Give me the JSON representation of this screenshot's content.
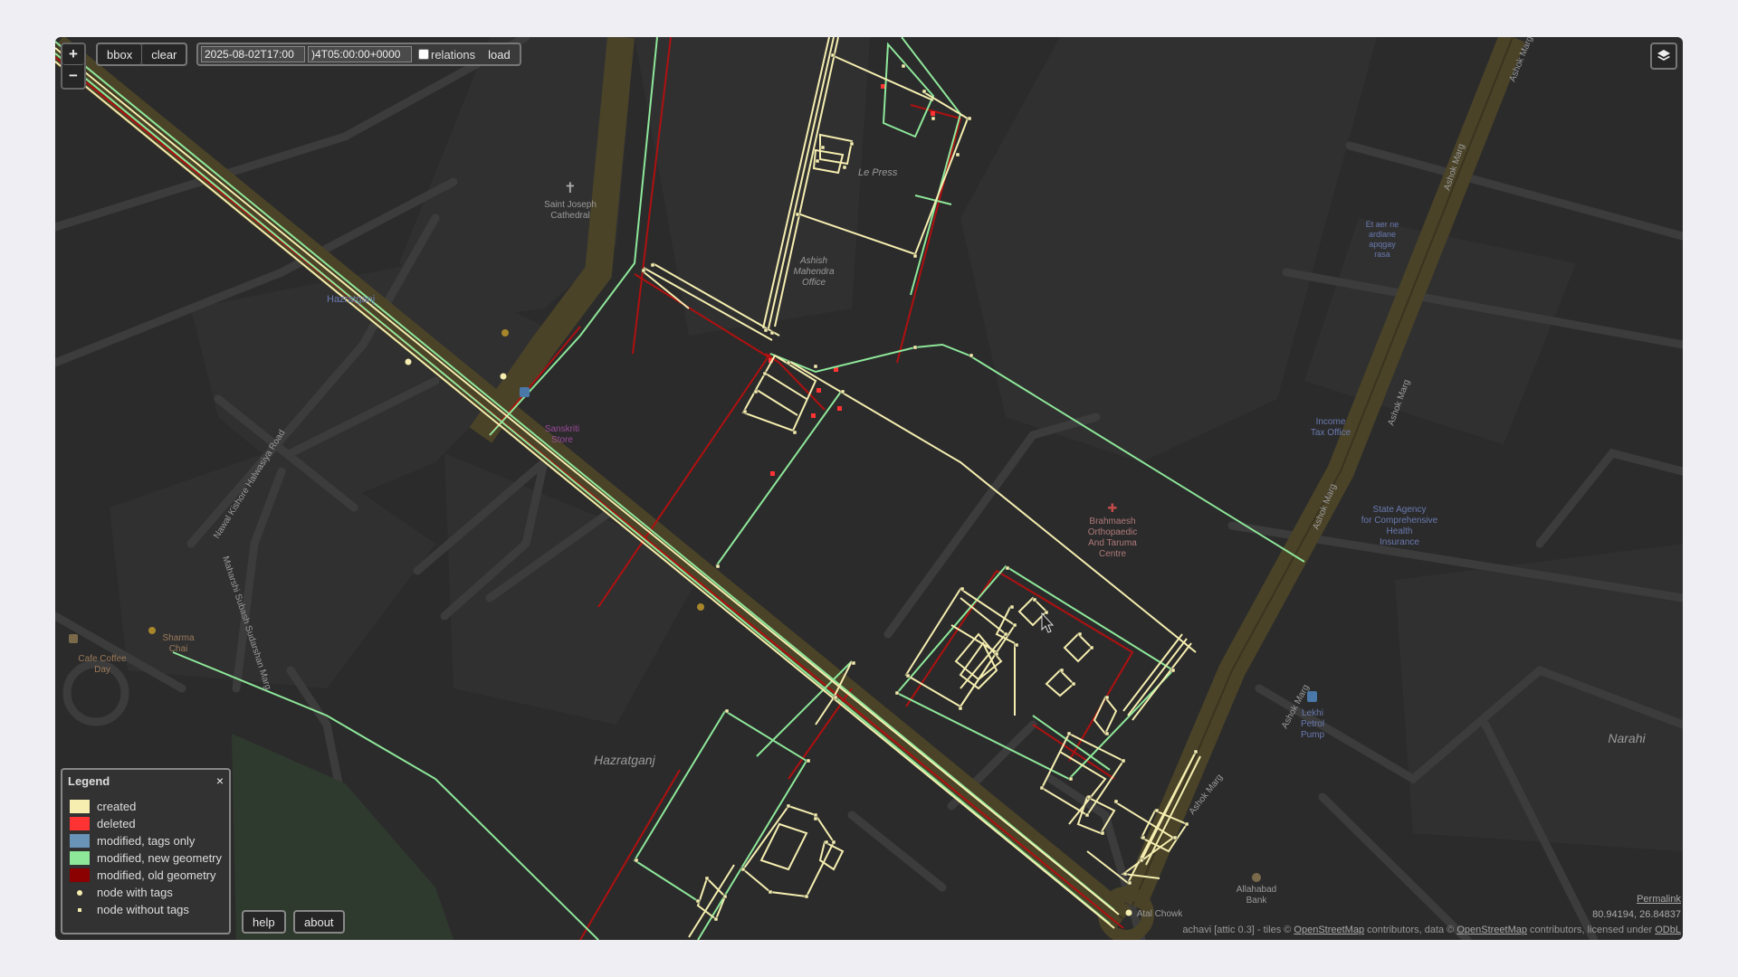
{
  "controls": {
    "zoom_in": "+",
    "zoom_out": "−",
    "bbox": "bbox",
    "clear": "clear",
    "time_from": "2025-08-02T17:00",
    "time_to": ")4T05:00:00+0000",
    "relations": "relations",
    "load": "load",
    "help": "help",
    "about": "about"
  },
  "legend": {
    "title": "Legend",
    "close": "×",
    "items": [
      {
        "label": "created",
        "color": "#f5eeb0"
      },
      {
        "label": "deleted",
        "color": "#ff3333"
      },
      {
        "label": "modified, tags only",
        "color": "#6a93b8"
      },
      {
        "label": "modified, new geometry",
        "color": "#8ee89a"
      },
      {
        "label": "modified, old geometry",
        "color": "#8b0000"
      },
      {
        "label": "node with tags"
      },
      {
        "label": "node without tags"
      }
    ]
  },
  "footer": {
    "permalink": "Permalink",
    "coords": "80.94194, 26.84837",
    "attribution": {
      "prefix": "achavi [attic 0.3]  -  tiles © ",
      "osm1": "OpenStreetMap",
      "mid1": " contributors, data © ",
      "osm2": "OpenStreetMap",
      "mid2": " contributors, licensed under ",
      "odbl": "ODbL"
    }
  },
  "map_labels": {
    "cathedral": [
      "Saint Joseph",
      "Cathedral"
    ],
    "hazratganj_top": "Hazratganj",
    "hazratganj": "Hazratganj",
    "le_press": "Le Press",
    "office": [
      "Ashish",
      "Mahendra",
      "Office"
    ],
    "road1": "Nawal Kishore Halwasiya Road",
    "road2": "Maharshi Subash Sudarshan Marg",
    "ashok1": "Ashok Marg",
    "ashok2": "Ashok Marg",
    "ashok3": "Ashok Marg",
    "ashok4": "Ashok Marg",
    "ashok5": "Ashok Marg",
    "ashok6": "Ashok Marg",
    "brahmaesh": [
      "Brahmaesh",
      "Orthopaedic",
      "And Taruma",
      "Centre"
    ],
    "income_tax": [
      "Income",
      "Tax Office"
    ],
    "state_agency": [
      "State Agency",
      "for Comprehensive",
      "Health",
      "Insurance"
    ],
    "kiosk": [
      "Et aer ne",
      "ardlane",
      "apqgay",
      "rasa"
    ],
    "lekhi": [
      "Lekhi",
      "Petrol",
      "Pump"
    ],
    "narahi": "Narahi",
    "allahabad": [
      "Allahabad",
      "Bank"
    ],
    "cafe": [
      "Cafe Coffee",
      "Day"
    ],
    "sharma": [
      "Sharma",
      "Chai"
    ],
    "atal": "Atal Chowk",
    "sanskriti": [
      "Sanskriti",
      "Store"
    ]
  },
  "colors": {
    "created": "#f5eeb0",
    "deleted": "#ff3333",
    "modified_new": "#8ee89a",
    "modified_old": "#b01010",
    "background": "#2b2b2b"
  }
}
